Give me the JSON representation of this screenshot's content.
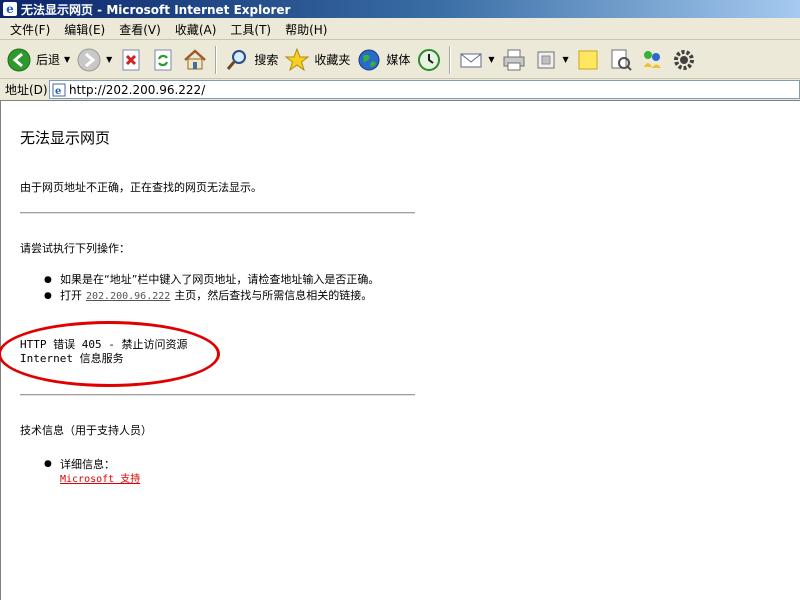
{
  "window": {
    "title": "无法显示网页 - Microsoft Internet Explorer"
  },
  "menu": [
    {
      "label": "文件(F)"
    },
    {
      "label": "编辑(E)"
    },
    {
      "label": "查看(V)"
    },
    {
      "label": "收藏(A)"
    },
    {
      "label": "工具(T)"
    },
    {
      "label": "帮助(H)"
    }
  ],
  "toolbar": {
    "back_label": "后退",
    "search_label": "搜索",
    "favorites_label": "收藏夹",
    "media_label": "媒体"
  },
  "address": {
    "label": "地址(D)",
    "url": "http://202.200.96.222/"
  },
  "page": {
    "title": "无法显示网页",
    "intro": "由于网页地址不正确，正在查找的网页无法显示。",
    "try_heading": "请尝试执行下列操作：",
    "suggestion1": "如果是在“地址”栏中键入了网页地址，请检查地址输入是否正确。",
    "suggestion2_pre": "打开",
    "suggestion2_link": "202.200.96.222",
    "suggestion2_post": "主页，然后查找与所需信息相关的链接。",
    "error_line1": "HTTP 错误 405 - 禁止访问资源",
    "error_line2": "Internet 信息服务",
    "tech_heading": "技术信息（用于支持人员）",
    "details_label": "详细信息：",
    "support_link": "Microsoft 支持"
  },
  "colors": {
    "annotation_circle": "#e00000",
    "support_link": "#e00000",
    "titlebar": "#0a246a"
  }
}
